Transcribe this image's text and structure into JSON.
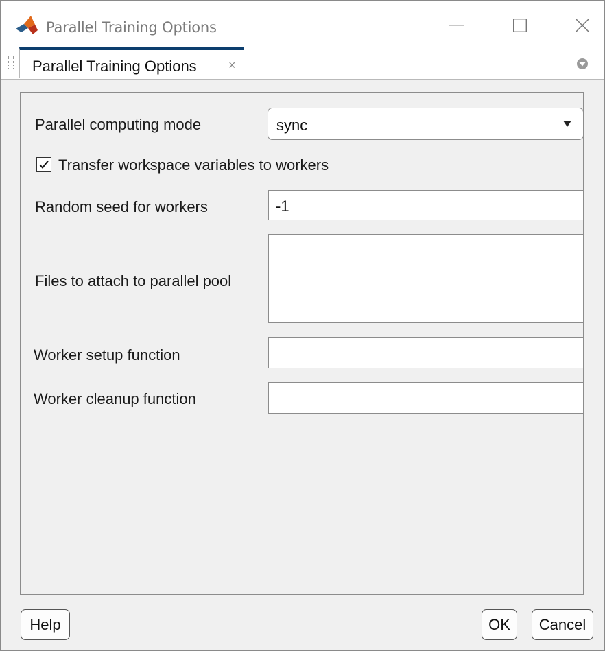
{
  "window": {
    "title": "Parallel Training Options",
    "controls": {
      "minimize_icon": "minimize-icon",
      "maximize_icon": "maximize-icon",
      "close_icon": "close-icon"
    }
  },
  "tabs": [
    {
      "label": "Parallel Training Options",
      "close_glyph": "×",
      "active": true
    }
  ],
  "form": {
    "parallel_mode": {
      "label": "Parallel computing mode",
      "value": "sync"
    },
    "transfer_vars": {
      "label": "Transfer workspace variables to workers",
      "checked": true
    },
    "random_seed": {
      "label": "Random seed for workers",
      "value": "-1"
    },
    "attach_files": {
      "label": "Files to attach to parallel pool",
      "value": ""
    },
    "setup_fn": {
      "label": "Worker setup function",
      "value": ""
    },
    "cleanup_fn": {
      "label": "Worker cleanup function",
      "value": ""
    }
  },
  "buttons": {
    "help": "Help",
    "ok": "OK",
    "cancel": "Cancel"
  },
  "colors": {
    "tab_accent": "#0c3e6e",
    "matlab_orange": "#e16a1b",
    "matlab_red": "#c4321b"
  }
}
